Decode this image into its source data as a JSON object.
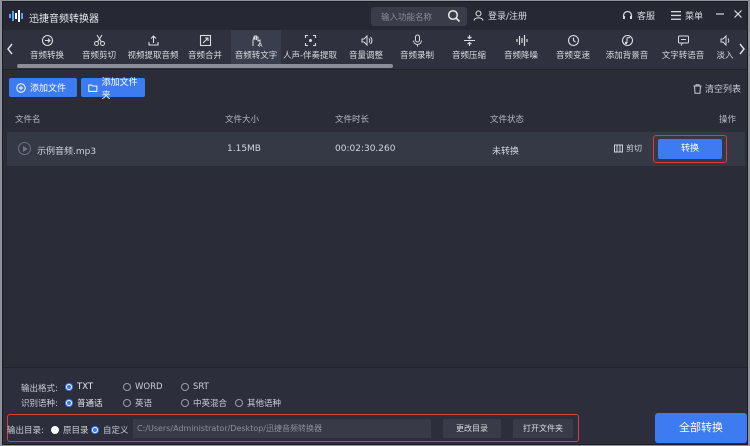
{
  "titlebar": {
    "app_title": "迅捷音频转换器",
    "search_placeholder": "输入功能名称",
    "login_label": "登录/注册",
    "service_label": "客服",
    "menu_label": "菜单"
  },
  "toolbar": {
    "tools": [
      {
        "label": "音频转换",
        "icon": "refresh-icon"
      },
      {
        "label": "音频剪切",
        "icon": "scissors-icon"
      },
      {
        "label": "视频提取音频",
        "icon": "upload-icon"
      },
      {
        "label": "音频合并",
        "icon": "merge-icon"
      },
      {
        "label": "音频转文字",
        "icon": "hand-text-icon"
      },
      {
        "label": "人声-伴奏提取",
        "icon": "scan-icon"
      },
      {
        "label": "音量调整",
        "icon": "volume-icon"
      },
      {
        "label": "音频录制",
        "icon": "microphone-icon"
      },
      {
        "label": "音频压缩",
        "icon": "compress-icon"
      },
      {
        "label": "音频降噪",
        "icon": "waveform-icon"
      },
      {
        "label": "音频变速",
        "icon": "speed-icon"
      },
      {
        "label": "添加背景音",
        "icon": "music-icon"
      },
      {
        "label": "文字转语音",
        "icon": "text-speech-icon"
      },
      {
        "label": "淡入",
        "icon": "fade-icon"
      }
    ],
    "active_tool": "音频转文字"
  },
  "actions": {
    "add_file": "添加文件",
    "add_folder": "添加文件夹",
    "clear_list": "清空列表"
  },
  "table": {
    "headers": {
      "name": "文件名",
      "size": "文件大小",
      "duration": "文件时长",
      "status": "文件状态",
      "operation": "操作"
    },
    "rows": [
      {
        "name": "示例音频.mp3",
        "size": "1.15MB",
        "duration": "00:02:30.260",
        "status": "未转换",
        "cut_label": "剪切",
        "convert_label": "转换"
      }
    ]
  },
  "bottom": {
    "format_label": "输出格式:",
    "formats": [
      "TXT",
      "WORD",
      "SRT"
    ],
    "selected_format": "TXT",
    "language_label": "识别语种:",
    "languages": [
      "普通话",
      "英语",
      "中英混合",
      "其他语种"
    ],
    "selected_language": "普通话",
    "output_label": "输出目录:",
    "dir_options": [
      "原目录",
      "自定义"
    ],
    "selected_dir": "自定义",
    "output_path": "C:/Users/Administrator/Desktop/迅捷音频转换器",
    "change_dir": "更改目录",
    "open_folder": "打开文件夹",
    "convert_all": "全部转换"
  },
  "colors": {
    "accent": "#3d7bf0",
    "highlight_frame": "#e03a3a",
    "background": "#2a2d38"
  }
}
